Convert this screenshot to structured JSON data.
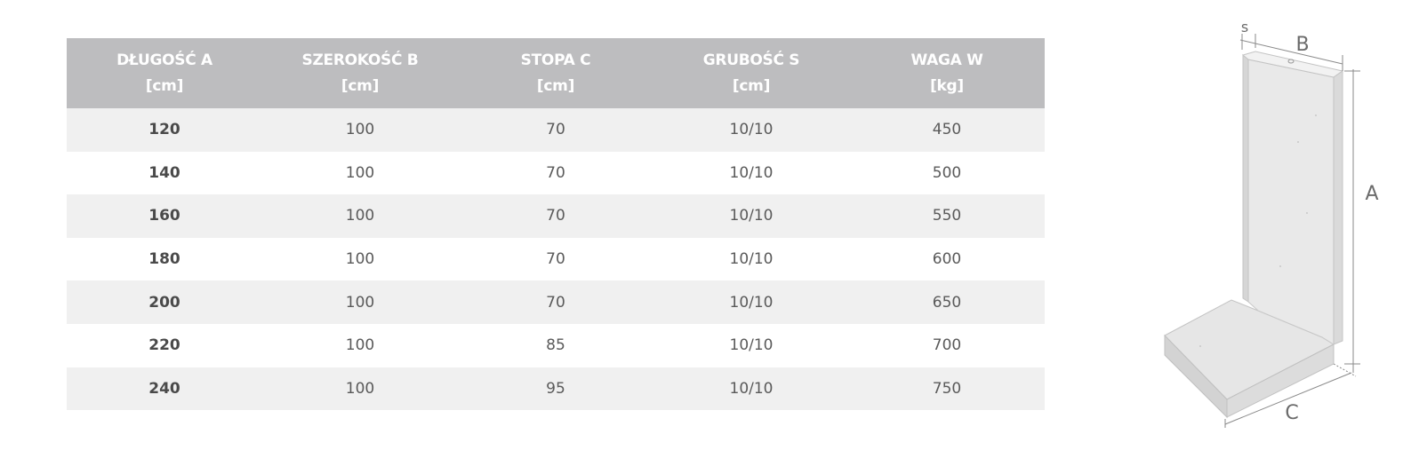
{
  "table": {
    "headers": [
      {
        "name": "DŁUGOŚĆ A",
        "unit": "[cm]"
      },
      {
        "name": "SZEROKOŚĆ B",
        "unit": "[cm]"
      },
      {
        "name": "STOPA C",
        "unit": "[cm]"
      },
      {
        "name": "GRUBOŚĆ S",
        "unit": "[cm]"
      },
      {
        "name": "WAGA W",
        "unit": "[kg]"
      }
    ],
    "rows": [
      [
        "120",
        "100",
        "70",
        "10/10",
        "450"
      ],
      [
        "140",
        "100",
        "70",
        "10/10",
        "500"
      ],
      [
        "160",
        "100",
        "70",
        "10/10",
        "550"
      ],
      [
        "180",
        "100",
        "70",
        "10/10",
        "600"
      ],
      [
        "200",
        "100",
        "70",
        "10/10",
        "650"
      ],
      [
        "220",
        "100",
        "85",
        "10/10",
        "700"
      ],
      [
        "240",
        "100",
        "95",
        "10/10",
        "750"
      ]
    ]
  },
  "diagram": {
    "labels": {
      "s": "s",
      "b": "B",
      "a": "A",
      "c": "C"
    }
  },
  "colors": {
    "header_bg": "#bdbdbf",
    "row_alt_bg": "#f0f0f0",
    "concrete": "#e2e2e2"
  }
}
